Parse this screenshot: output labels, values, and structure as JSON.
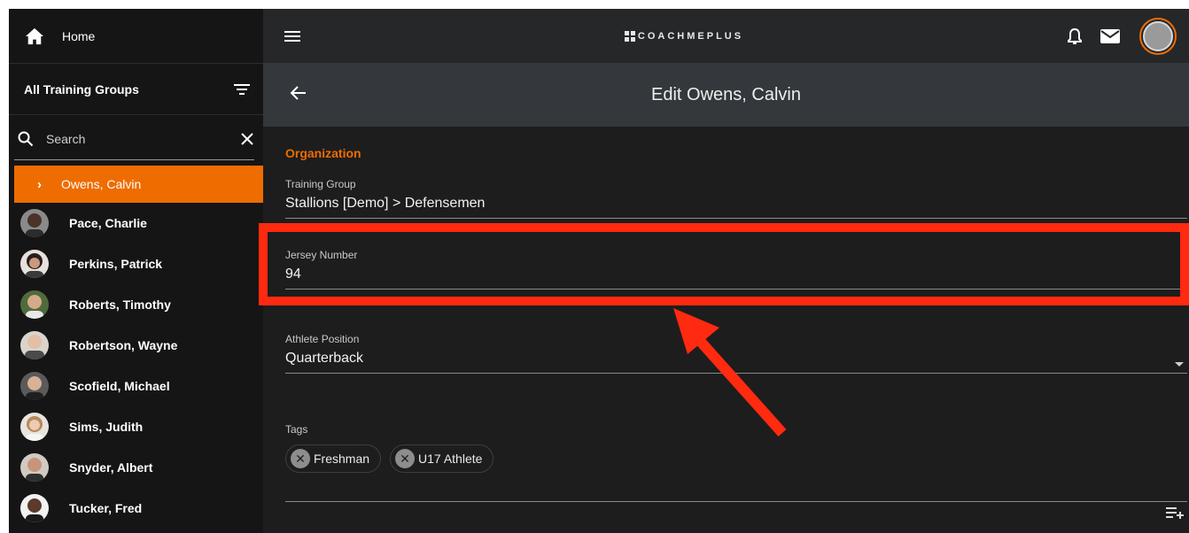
{
  "sidebar": {
    "home_label": "Home",
    "groups_label": "All Training Groups",
    "search_placeholder": "Search",
    "active_athlete": "Owens, Calvin",
    "athletes": [
      {
        "name": "Pace, Charlie"
      },
      {
        "name": "Perkins, Patrick"
      },
      {
        "name": "Roberts, Timothy"
      },
      {
        "name": "Robertson, Wayne"
      },
      {
        "name": "Scofield, Michael"
      },
      {
        "name": "Sims, Judith"
      },
      {
        "name": "Snyder, Albert"
      },
      {
        "name": "Tucker, Fred"
      }
    ]
  },
  "topbar": {
    "brand": "COACHMEPLUS"
  },
  "page": {
    "title": "Edit Owens, Calvin",
    "section_title": "Organization",
    "training_group": {
      "label": "Training Group",
      "value": "Stallions [Demo] > Defensemen"
    },
    "jersey_number": {
      "label": "Jersey Number",
      "value": "94"
    },
    "athlete_position": {
      "label": "Athlete Position",
      "value": "Quarterback"
    },
    "tags": {
      "label": "Tags",
      "items": [
        "Freshman",
        "U17 Athlete"
      ]
    }
  },
  "colors": {
    "accent": "#ef6c00",
    "annotation": "#ff2a10",
    "sidebar_bg": "#151515",
    "header_bg": "#34383c"
  },
  "icons": {
    "home": "home-icon",
    "filter": "filter-icon",
    "search": "search-icon",
    "clear": "close-icon",
    "menu": "hamburger-menu-icon",
    "notifications": "bell-icon",
    "messages": "mail-icon",
    "back": "arrow-back-icon",
    "add_tag": "playlist-add-icon"
  }
}
